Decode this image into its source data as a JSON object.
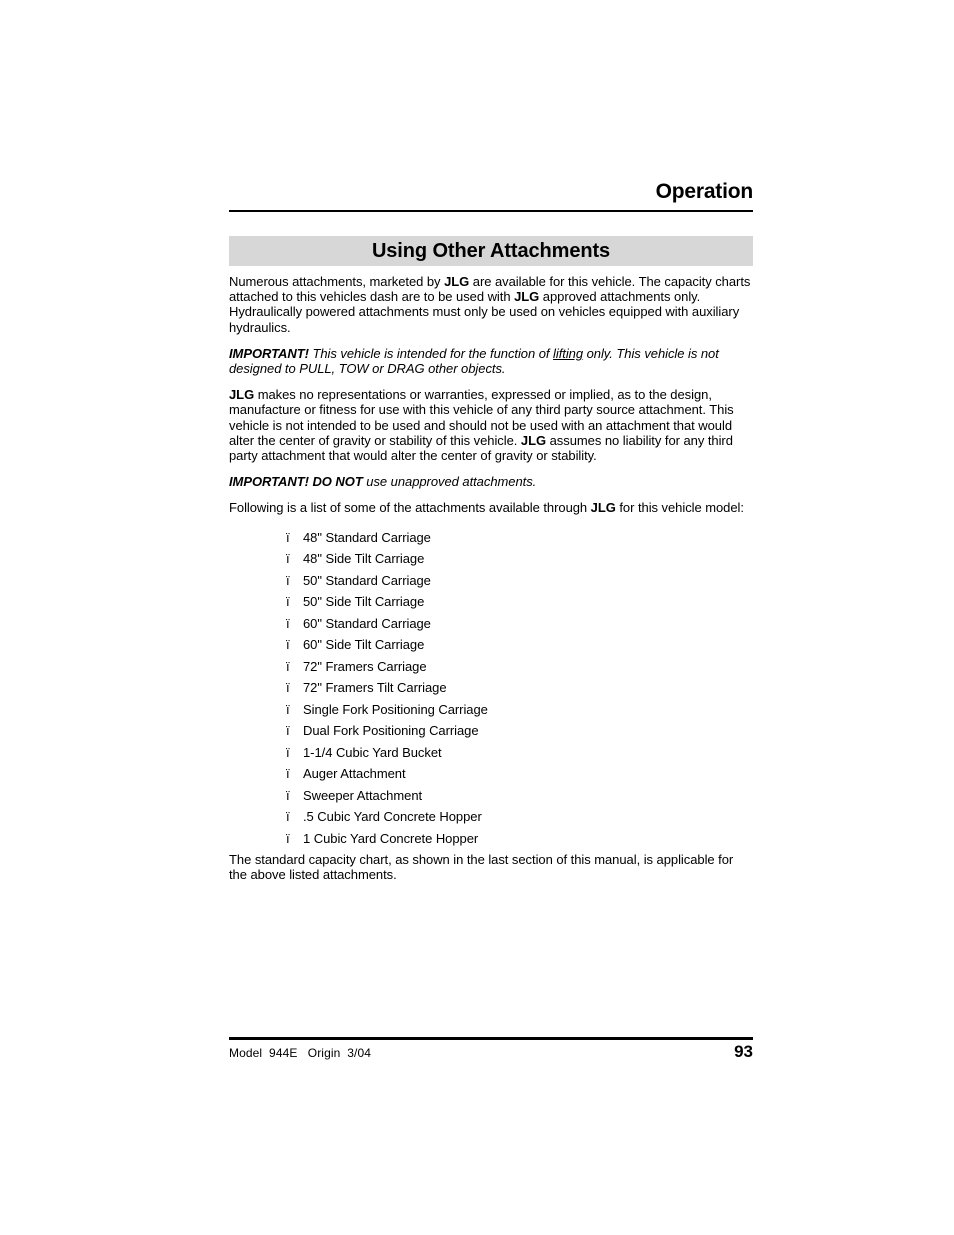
{
  "header": {
    "running_head": "Operation"
  },
  "section": {
    "title": "Using Other Attachments"
  },
  "paragraphs": {
    "intro_1": "Numerous attachments, marketed by ",
    "intro_1_b1": "JLG",
    "intro_1_b": " are available for this vehicle. The capacity charts attached to this vehicles dash are to be used with ",
    "intro_1_b2": "JLG",
    "intro_1_c": " approved attachments only. Hydraulically powered attachments must only be used on vehicles equipped with auxiliary hydraulics.",
    "important_1_label": "IMPORTANT!",
    "important_1_a": " This vehicle is intended for the function of ",
    "important_1_underlined": "lifting",
    "important_1_b": " only. This vehicle is not designed to PULL, TOW or DRAG other objects.",
    "disclaimer_b1": "JLG",
    "disclaimer_a": " makes no representations or warranties, expressed or implied, as to the design, manufacture or fitness for use with this vehicle of any third party source attachment. This vehicle is not intended to be used and should not be used with an attachment that would alter the center of gravity or stability of this vehicle. ",
    "disclaimer_b2": "JLG",
    "disclaimer_b": " assumes no liability for any third party attachment that would alter the center of gravity or stability.",
    "important_2_label": "IMPORTANT! DO NOT",
    "important_2_text": " use unapproved attachments.",
    "list_intro_a": "Following is a list of some of the attachments available through ",
    "list_intro_b1": "JLG",
    "list_intro_b": " for this vehicle model:",
    "closing": "The standard capacity chart, as shown in the last section of this manual, is applicable for the above listed attachments."
  },
  "list": {
    "bullet_glyph": "ï",
    "items": [
      "48\" Standard Carriage",
      "48\" Side Tilt Carriage",
      "50\" Standard Carriage",
      "50\" Side Tilt Carriage",
      "60\" Standard Carriage",
      "60\" Side Tilt Carriage",
      "72\" Framers Carriage",
      "72\" Framers Tilt Carriage",
      "Single Fork Positioning Carriage",
      "Dual Fork Positioning Carriage",
      "1-1/4 Cubic Yard Bucket",
      "Auger Attachment",
      "Sweeper Attachment",
      ".5 Cubic Yard Concrete Hopper",
      "1 Cubic Yard Concrete Hopper"
    ]
  },
  "footer": {
    "model_line": "Model  944E   Origin  3/04",
    "page_number": "93"
  },
  "colors": {
    "title_bar_background": "#d7d7d7",
    "text": "#000000",
    "page_background": "#ffffff"
  }
}
